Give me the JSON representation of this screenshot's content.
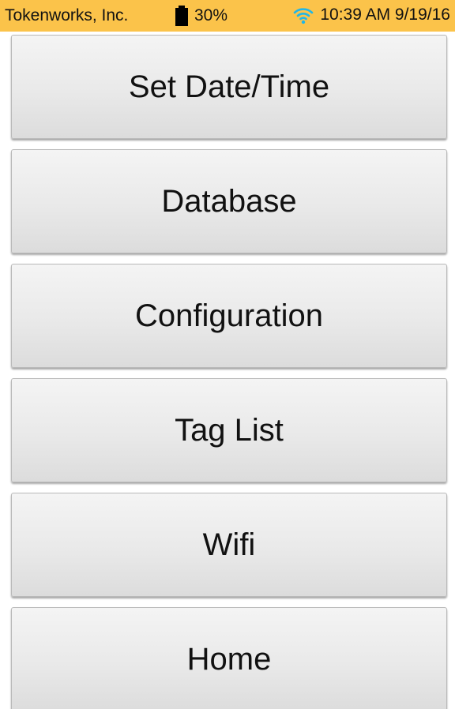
{
  "status_bar": {
    "company": "Tokenworks, Inc.",
    "battery_icon": "battery-icon",
    "battery_percent": "30%",
    "wifi_icon": "wifi-icon",
    "clock": "10:39 AM 9/19/16",
    "background_color": "#fbc34a",
    "wifi_color": "#1fb6e8"
  },
  "menu": {
    "buttons": [
      {
        "label": "Set Date/Time"
      },
      {
        "label": "Database"
      },
      {
        "label": "Configuration"
      },
      {
        "label": "Tag List"
      },
      {
        "label": "Wifi"
      },
      {
        "label": "Home"
      }
    ]
  }
}
